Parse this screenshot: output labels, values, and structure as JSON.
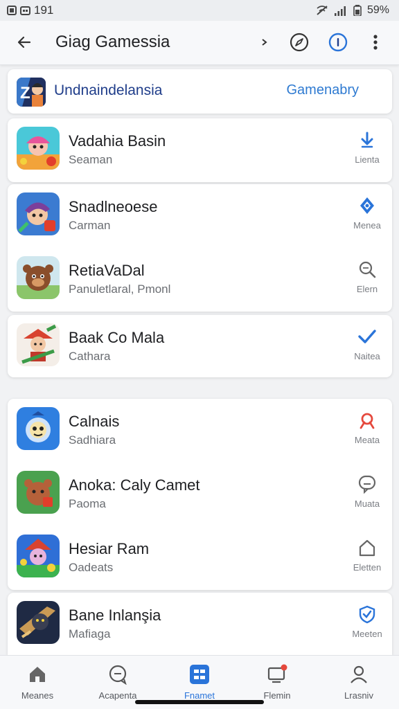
{
  "status": {
    "time": "191",
    "battery": "59%"
  },
  "app_bar": {
    "title": "Giag Gamessia"
  },
  "header_card": {
    "title": "Undnaindelansia",
    "link": "Gamenabry"
  },
  "groups": [
    {
      "items": [
        {
          "name": "Vadahia Basin",
          "sub": "Seaman",
          "action": "Lienta",
          "icon": "download-icon"
        }
      ]
    },
    {
      "items": [
        {
          "name": "Snadlneoese",
          "sub": "Carman",
          "action": "Menea",
          "icon": "diamond-icon"
        },
        {
          "name": "RetiaVaDal",
          "sub": "Panuletlaral, Pmonl",
          "action": "Elern",
          "icon": "search-icon"
        }
      ]
    },
    {
      "items": [
        {
          "name": "Baak Co Mala",
          "sub": "Cathara",
          "action": "Naitea",
          "icon": "check-icon"
        }
      ]
    },
    {
      "items": [
        {
          "name": "Calnais",
          "sub": "Sadhiara",
          "action": "Meata",
          "icon": "heart-icon"
        },
        {
          "name": "Anoka: Caly Camet",
          "sub": "Paoma",
          "action": "Muata",
          "icon": "chat-icon"
        },
        {
          "name": "Hesiar Ram",
          "sub": "Oadeats",
          "action": "Eletten",
          "icon": "home-icon"
        }
      ]
    },
    {
      "items": [
        {
          "name": "Bane Inlanşia",
          "sub": "Mafiaga",
          "action": "Meeten",
          "icon": "shield-icon"
        }
      ]
    }
  ],
  "nav": [
    {
      "label": "Meanes",
      "icon": "home-icon"
    },
    {
      "label": "Acapenta",
      "icon": "chat-icon"
    },
    {
      "label": "Fnamet",
      "icon": "grid-icon"
    },
    {
      "label": "Flemin",
      "icon": "inbox-icon"
    },
    {
      "label": "Lrasniv",
      "icon": "user-icon"
    }
  ],
  "colors": {
    "accent": "#2a74d9",
    "title_blue": "#1f3d8a",
    "notification": "#e5483c"
  }
}
